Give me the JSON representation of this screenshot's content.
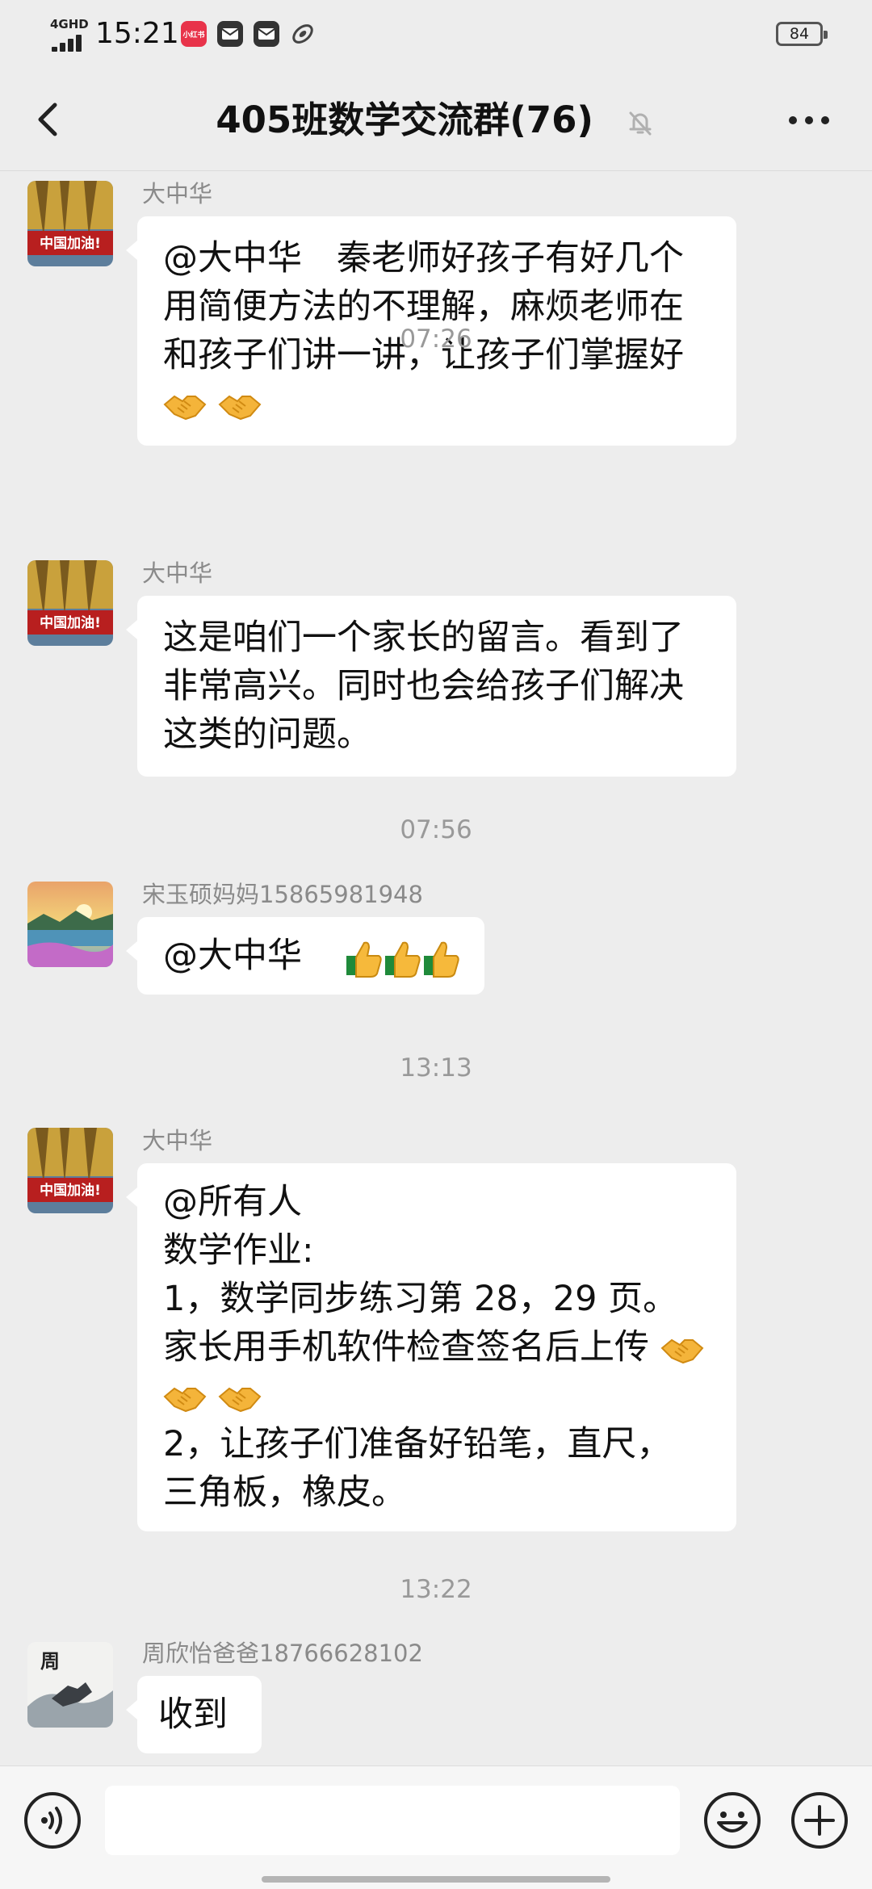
{
  "status_bar": {
    "network": "4GHD",
    "time": "15:21",
    "app_badge": "小红书",
    "battery": "84"
  },
  "header": {
    "title": "405班数学交流群(76)"
  },
  "messages": [
    {
      "sender": "大中华",
      "lines": [
        "@大中华　秦老师好孩子有好几个",
        "用简便方法的不理解，麻烦老师在",
        "和孩子们讲一讲，让孩子们掌握好"
      ],
      "emoji_line_count": 2
    },
    {
      "sender": "大中华",
      "lines": [
        "这是咱们一个家长的留言。看到了",
        "非常高兴。同时也会给孩子们解决",
        "这类的问题。"
      ]
    },
    {
      "sender": "宋玉硕妈妈15865981948",
      "text": "@大中华"
    },
    {
      "sender": "大中华",
      "lines": [
        "@所有人",
        "数学作业:",
        "1，数学同步练习第 28，29 页。",
        "家长用手机软件检查签名后上传",
        "2，让孩子们准备好铅笔，直尺，",
        "三角板，橡皮。"
      ]
    },
    {
      "sender": "周欣怡爸爸18766628102",
      "text": "收到"
    }
  ],
  "timestamps": [
    "07:26",
    "07:56",
    "13:13",
    "13:22"
  ],
  "avatar_badge": "中国加油!",
  "avatar_seal": "周",
  "icons": {
    "back": "chevron-left-icon",
    "mute": "bell-off-icon",
    "more": "more-dots-icon",
    "voice": "voice-icon",
    "emoji": "emoji-face-icon",
    "plus": "plus-circle-icon",
    "handshake": "handshake-emoji",
    "thumbs_up": "thumbs-up-emoji"
  },
  "colors": {
    "background": "#ededed",
    "bubble": "#ffffff",
    "sender": "#8a8a8a",
    "timestamp": "#999999"
  }
}
